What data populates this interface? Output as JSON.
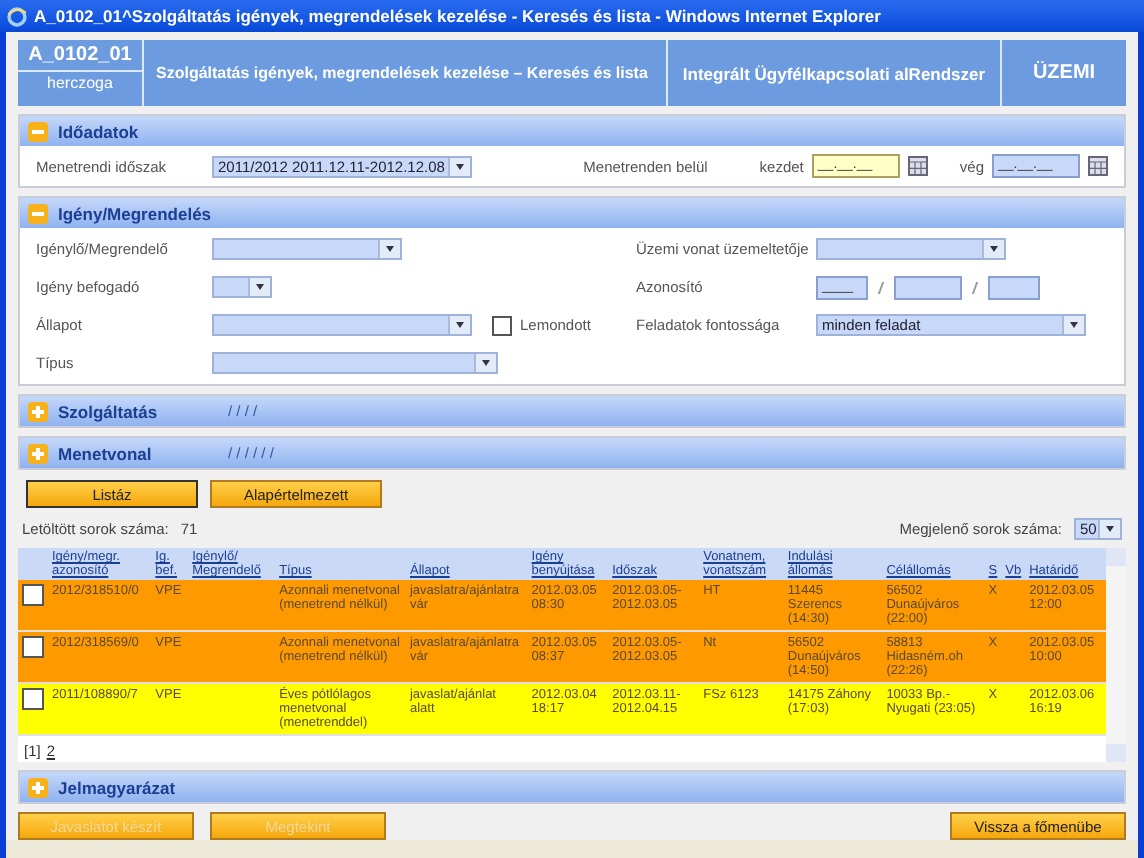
{
  "window": {
    "title": "A_0102_01^Szolgáltatás igények, megrendelések kezelése - Keresés és lista - Windows Internet Explorer"
  },
  "header": {
    "code": "A_0102_01",
    "user": "herczoga",
    "title": "Szolgáltatás igények, megrendelések kezelése – Keresés és lista",
    "system": "Integrált Ügyfélkapcsolati alRendszer",
    "mode": "ÜZEMI"
  },
  "time_section": {
    "title": "Időadatok",
    "expanded": true,
    "period_label": "Menetrendi időszak",
    "period_value": "2011/2012 2011.12.11-2012.12.08",
    "within_label": "Menetrenden belül",
    "start_label": "kezdet",
    "start_value": "__.__.__",
    "end_label": "vég",
    "end_value": "__.__.__"
  },
  "request_section": {
    "title": "Igény/Megrendelés",
    "expanded": true,
    "left_fields": [
      {
        "label": "Igénylő/Megrendelő"
      },
      {
        "label": "Igény befogadó"
      },
      {
        "label": "Állapot"
      },
      {
        "label": "Típus"
      }
    ],
    "cancelled": {
      "label": "Lemondott",
      "checked": false
    },
    "operator_label": "Üzemi vonat üzemeltetője",
    "id_label": "Azonosító",
    "id_first": "____",
    "priority_label": "Feladatok fontossága",
    "priority_value": "minden feladat"
  },
  "collapsed_sections": [
    {
      "title": "Szolgáltatás",
      "summary": "/ / / /",
      "expanded": false
    },
    {
      "title": "Menetvonal",
      "summary": "/ / / / / /",
      "expanded": false
    }
  ],
  "search_buttons": [
    "Listáz",
    "Alapértelmezett"
  ],
  "result_count_label": "Letöltött sorok száma:",
  "result_count": "71",
  "page_size_label": "Megjelenő sorok száma:",
  "page_size": "50",
  "table": {
    "columns": [
      "Igény/megr. azonosító",
      "Ig. bef.",
      "Igénylő/ Megrendelő",
      "Típus",
      "Állapot",
      "Igény benyújtása",
      "Időszak",
      "Vonatnem, vonatszám",
      "Indulási állomás",
      "Célállomás",
      "S",
      "Vb",
      "Határidő"
    ],
    "rows": [
      {
        "color": "#ff9900",
        "checked": false,
        "cells": [
          "2012/318510/0",
          "VPE",
          "",
          "Azonnali menetvonal (menetrend nélkül)",
          "javaslatra/ajánlatra vár",
          "2012.03.05 08:30",
          "2012.03.05-2012.03.05",
          "HT",
          "11445 Szerencs (14:30)",
          "56502 Dunaújváros (22:00)",
          "X",
          "",
          "2012.03.05 12:00"
        ]
      },
      {
        "color": "#ff9900",
        "checked": false,
        "cells": [
          "2012/318569/0",
          "VPE",
          "",
          "Azonnali menetvonal (menetrend nélkül)",
          "javaslatra/ajánlatra vár",
          "2012.03.05 08:37",
          "2012.03.05-2012.03.05",
          "Nt",
          "56502 Dunaújváros (14:50)",
          "58813 Hidasném.oh (22:26)",
          "X",
          "",
          "2012.03.05 10:00"
        ]
      },
      {
        "color": "#ffff00",
        "checked": false,
        "cells": [
          "2011/108890/7",
          "VPE",
          "",
          "Éves pótlólagos menetvonal (menetrenddel)",
          "javaslat/ajánlat alatt",
          "2012.03.04 18:17",
          "2012.03.11-2012.04.15",
          "FSz 6123",
          "14175 Záhony (17:03)",
          "10033 Bp.-Nyugati (23:05)",
          "X",
          "",
          "2012.03.06 16:19"
        ]
      }
    ],
    "pages": [
      {
        "label": "[1]",
        "selected": true
      },
      {
        "label": "2",
        "selected": false
      }
    ]
  },
  "legend_section": {
    "title": "Jelmagyarázat",
    "expanded": false
  },
  "bottom_buttons": [
    {
      "label": "Javaslatot készít",
      "disabled": true
    },
    {
      "label": "Megtekint",
      "disabled": true
    },
    {
      "label": "Vissza a főmenübe",
      "disabled": false
    }
  ]
}
